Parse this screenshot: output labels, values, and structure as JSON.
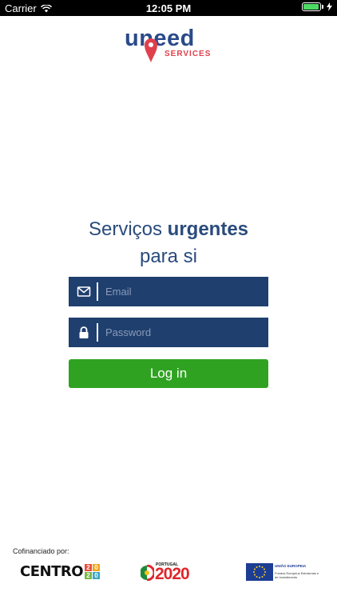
{
  "status_bar": {
    "carrier": "Carrier",
    "time": "12:05 PM"
  },
  "logo": {
    "word": "uneed",
    "sub": "SERVICES",
    "brand_color": "#2a4a8a",
    "accent_color": "#e0404b"
  },
  "headline": {
    "line1_regular": "Serviços ",
    "line1_bold": "urgentes",
    "line2": "para si"
  },
  "form": {
    "email_placeholder": "Email",
    "email_value": "",
    "password_placeholder": "Password",
    "password_value": "",
    "login_label": "Log in",
    "field_color": "#1f3f6e",
    "button_color": "#2fa321"
  },
  "footer": {
    "cofinanced_label": "Cofinanciado por:",
    "centro_text": "CENTRO",
    "centro_digits": [
      "2",
      "0",
      "2",
      "0"
    ],
    "portugal_label": "PORTUGAL",
    "portugal_year": "2020",
    "eu_title": "UNIÃO EUROPEIA",
    "eu_sub": "Fundos Europeus Estruturais e de Investimento"
  }
}
